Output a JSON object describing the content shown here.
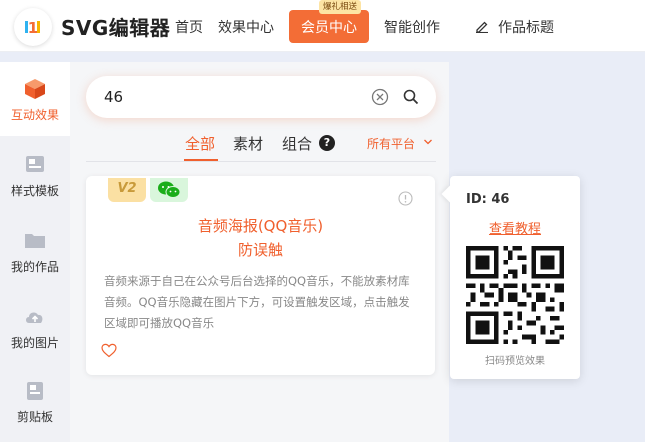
{
  "app": {
    "logo_text": "SVG编辑器"
  },
  "nav": {
    "home": "首页",
    "effects": "效果中心",
    "member": "会员中心",
    "promo_tag": "爆礼相送",
    "ai": "智能创作",
    "work_title": "作品标题"
  },
  "sidebar": {
    "items": [
      {
        "label": "互动效果",
        "icon": "cube-icon",
        "active": true
      },
      {
        "label": "样式模板",
        "icon": "template-icon",
        "active": false
      },
      {
        "label": "我的作品",
        "icon": "folder-icon",
        "active": false
      },
      {
        "label": "我的图片",
        "icon": "cloud-upload-icon",
        "active": false
      },
      {
        "label": "剪贴板",
        "icon": "clipboard-icon",
        "active": false
      }
    ]
  },
  "search": {
    "value": "46"
  },
  "filter_tabs": {
    "all": "全部",
    "materials": "素材",
    "combos": "组合",
    "help": "?",
    "platform": "所有平台"
  },
  "card": {
    "badge_version": "V2",
    "title_line1": "音频海报(QQ音乐)",
    "title_line2": "防误触",
    "description": "音频来源于自己在公众号后台选择的QQ音乐，不能放素材库音频。QQ音乐隐藏在图片下方，可设置触发区域，点击触发区域即可播放QQ音乐"
  },
  "preview": {
    "id_label": "ID: 46",
    "tutorial_link": "查看教程",
    "caption": "扫码预览效果"
  },
  "colors": {
    "accent": "#f0602e",
    "member_button": "#f36d36",
    "sidebar_bg": "#f0f1f5"
  }
}
